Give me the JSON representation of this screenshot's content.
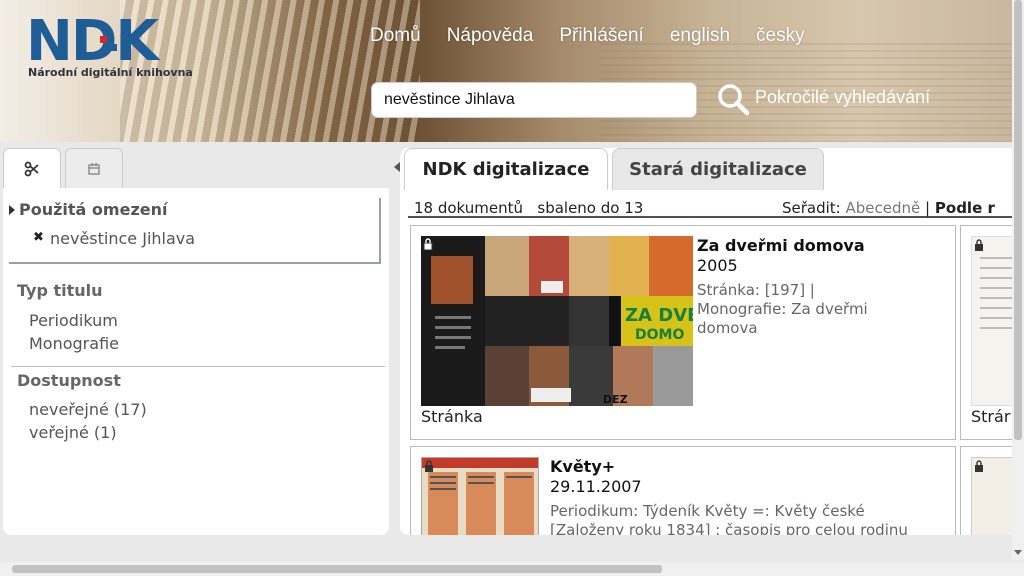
{
  "logo": {
    "letters": "NDK",
    "subtitle": "Národní digitální knihovna"
  },
  "topnav": [
    "Domů",
    "Nápověda",
    "Přihlášení",
    "english",
    "česky"
  ],
  "search": {
    "value": "nevěstince Jihlava"
  },
  "advanced_search": "Pokročilé vyhledávání",
  "left_tabs": [
    {
      "icon": "scissors-icon"
    },
    {
      "icon": "calendar-icon"
    }
  ],
  "constraints": {
    "title": "Použitá omezení",
    "items": [
      "nevěstince Jihlava"
    ]
  },
  "facets": [
    {
      "title": "Typ titulu",
      "items": [
        "Periodikum",
        "Monografie"
      ]
    },
    {
      "title": "Dostupnost",
      "items": [
        "neveřejné (17)",
        "veřejné (1)"
      ]
    }
  ],
  "right_tabs": [
    "NDK digitalizace",
    "Stará digitalizace"
  ],
  "results": {
    "count": "18 dokumentů",
    "collapsed": "sbaleno do 13",
    "sort_label": "Seřadit:",
    "sort_alpha": "Abecedně",
    "sort_sep": "|",
    "sort_relevance": "Podle r"
  },
  "cards": [
    {
      "title": "Za dveřmi domova",
      "date": "2005",
      "meta1": "Stránka: [197]       |",
      "meta2": " Monografie: Za dveřmi",
      "meta3": "domova",
      "label": "Stránka"
    },
    {
      "title": "Květy+",
      "date": "29.11.2007",
      "meta1": "Periodikum: Týdeník Květy =: Květy české",
      "meta2": "[Založeny roku 1834] : časopis pro celou rodinu"
    }
  ],
  "partial_card_label": "Strár",
  "colors": {
    "logo_blue": "#1f5d96",
    "logo_red": "#d7262c"
  }
}
